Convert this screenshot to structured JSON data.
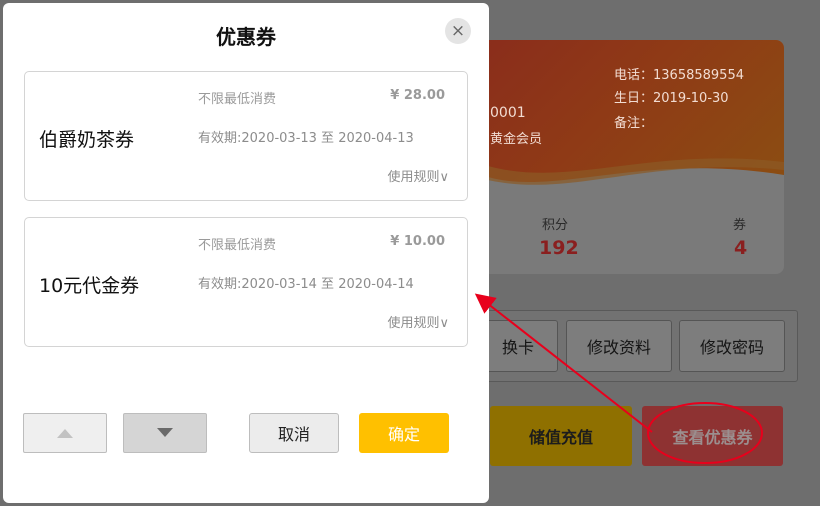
{
  "background": {
    "card": {
      "phone": "电话：13658589554",
      "birthday": "生日：2019-10-30",
      "remark": "备注：",
      "card_no": "0001",
      "level": "黄金会员",
      "points_label": "积分",
      "points_value": "192",
      "coupons_label": "券",
      "coupons_value": "4"
    },
    "buttons": {
      "change_card": "换卡",
      "edit_profile": "修改资料",
      "change_password": "修改密码",
      "recharge": "储值充值",
      "view_coupons": "查看优惠券"
    }
  },
  "modal": {
    "title": "优惠券",
    "close_symbol": "×",
    "coupons": [
      {
        "name": "伯爵奶茶券",
        "min_spend": "不限最低消费",
        "amount": "¥ 28.00",
        "validity": "有效期:2020-03-13 至 2020-04-13",
        "rules": "使用规则∨"
      },
      {
        "name": "10元代金券",
        "min_spend": "不限最低消费",
        "amount": "¥ 10.00",
        "validity": "有效期:2020-03-14 至 2020-04-14",
        "rules": "使用规则∨"
      }
    ],
    "cancel_label": "取消",
    "ok_label": "确定"
  },
  "icons": {
    "prev": "chevron-up-icon",
    "next": "chevron-down-icon",
    "close": "close-icon"
  },
  "colors": {
    "confirm_button": "#ffc000",
    "annotation": "#e8001c",
    "points_value": "#8a1f1f"
  }
}
